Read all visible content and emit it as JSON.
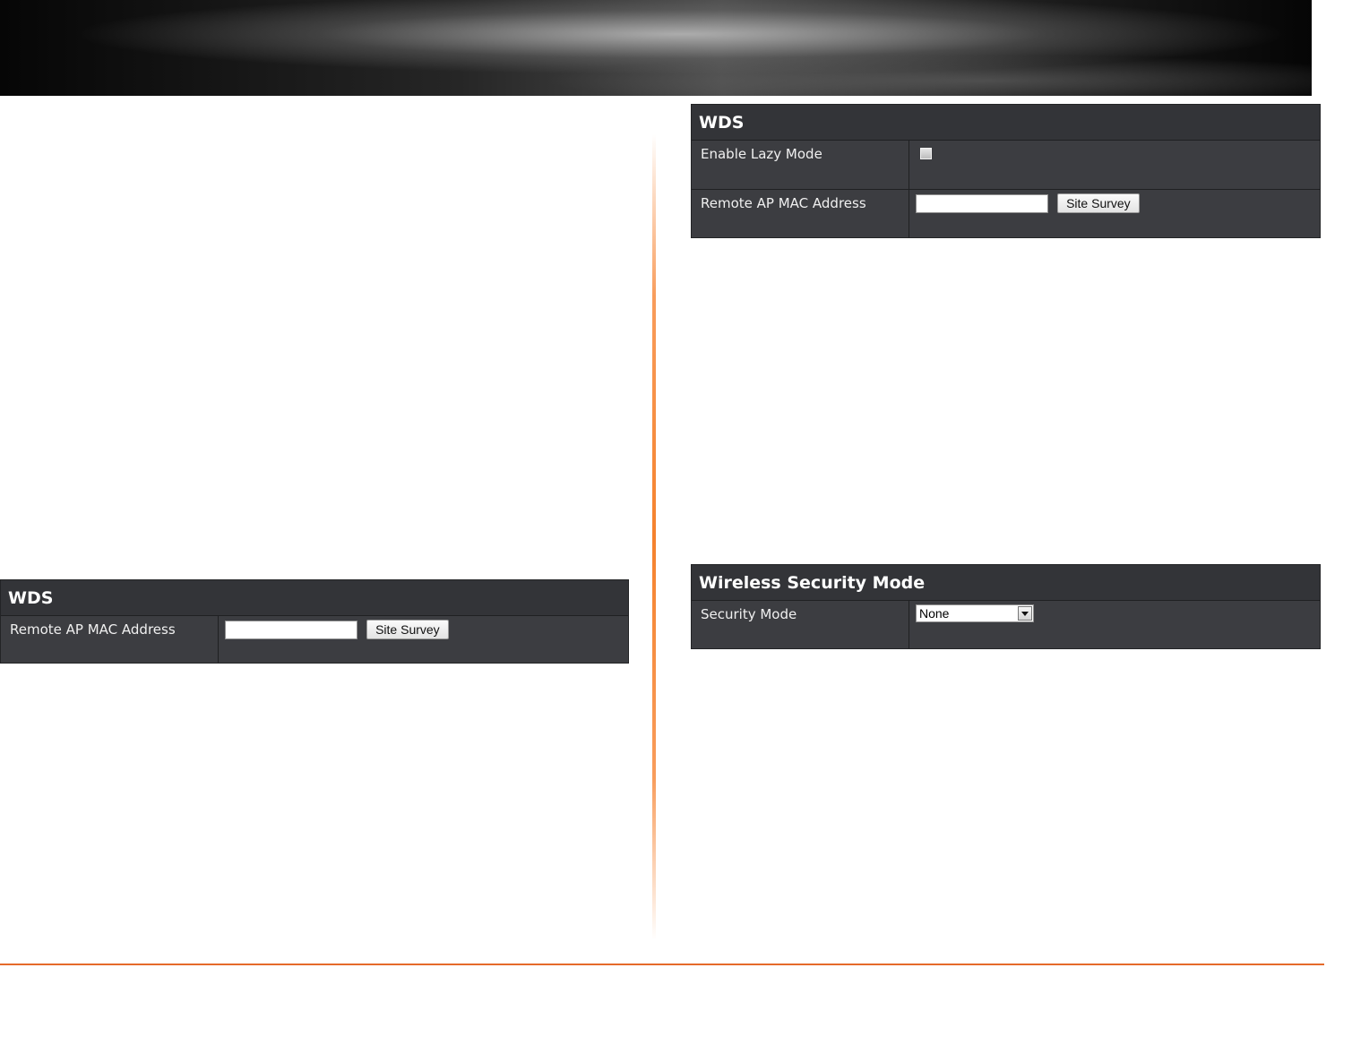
{
  "panel_left": {
    "title": "WDS",
    "rows": [
      {
        "label": "Remote AP MAC Address",
        "input_value": "",
        "button_label": "Site Survey"
      }
    ]
  },
  "panel_right_top": {
    "title": "WDS",
    "rows": [
      {
        "label": "Enable Lazy Mode",
        "checked": false
      },
      {
        "label": "Remote AP MAC Address",
        "input_value": "",
        "button_label": "Site Survey"
      }
    ]
  },
  "panel_security": {
    "title": "Wireless Security Mode",
    "rows": [
      {
        "label": "Security Mode",
        "selected": "None"
      }
    ]
  },
  "colors": {
    "panel_bg": "#3c3d41",
    "header_bg": "#333438",
    "accent_orange": "#e56a2a"
  }
}
